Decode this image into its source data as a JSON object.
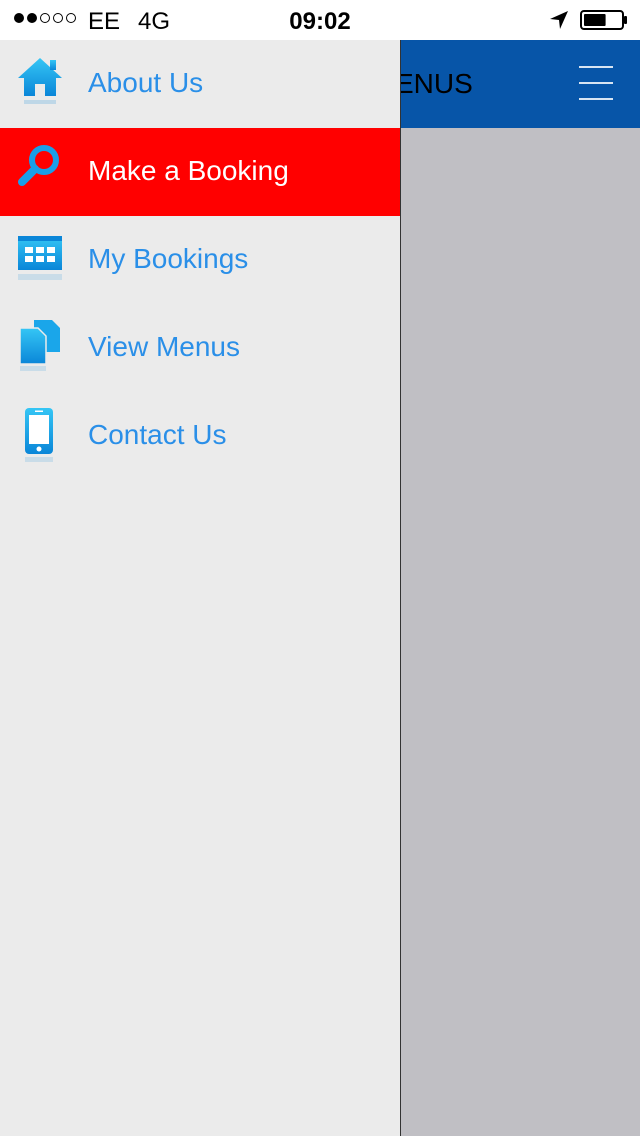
{
  "status_bar": {
    "signal_dots_filled": 2,
    "signal_dots_total": 5,
    "carrier": "EE",
    "network": "4G",
    "time": "09:02",
    "battery_level": 0.6,
    "icons": [
      "location-arrow-icon",
      "battery-icon"
    ]
  },
  "main_view": {
    "title_fragment": "ENUS",
    "header_color": "#0755a8",
    "background_color": "#c0bfc4",
    "menu_button_icon": "hamburger-icon"
  },
  "drawer": {
    "background_color": "#ebebeb",
    "active_color": "#ff0000",
    "label_color": "#2a8fe8",
    "items": [
      {
        "label": "About Us",
        "icon": "home-icon",
        "active": false
      },
      {
        "label": "Make a Booking",
        "icon": "search-icon",
        "active": true
      },
      {
        "label": "My Bookings",
        "icon": "calendar-icon",
        "active": false
      },
      {
        "label": "View Menus",
        "icon": "documents-icon",
        "active": false
      },
      {
        "label": "Contact Us",
        "icon": "phone-icon",
        "active": false
      }
    ]
  }
}
